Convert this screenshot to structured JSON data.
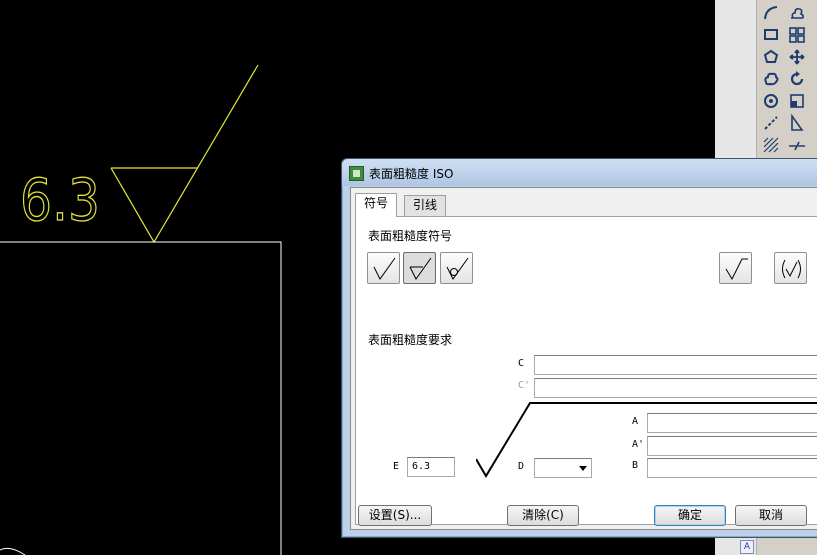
{
  "drawing": {
    "roughness_value": "6.3"
  },
  "dialog": {
    "title": "表面粗糙度 ISO",
    "tabs": [
      {
        "label": "符号"
      },
      {
        "label": "引线"
      }
    ],
    "symbol_section_title": "表面粗糙度符号",
    "symbol_buttons": [
      {
        "icon": "basic-surface-symbol-icon"
      },
      {
        "icon": "material-removal-required-icon"
      },
      {
        "icon": "material-removal-prohibited-icon"
      },
      {
        "icon": "all-around-symbol-icon"
      },
      {
        "icon": "parenthesized-symbol-icon"
      }
    ],
    "requirements_section_title": "表面粗糙度要求",
    "fields": {
      "C": {
        "label": "C",
        "value": ""
      },
      "C_prime": {
        "label": "C'",
        "value": ""
      },
      "A": {
        "label": "A",
        "value": ""
      },
      "A_prime": {
        "label": "A'",
        "value": ""
      },
      "B": {
        "label": "B",
        "value": ""
      },
      "E": {
        "label": "E",
        "value": "6.3"
      },
      "D": {
        "label": "D",
        "value": ""
      }
    },
    "buttons": {
      "settings": "设置(S)...",
      "clear": "清除(C)",
      "ok": "确定",
      "cancel": "取消"
    }
  },
  "toolbar": {
    "icons": [
      "arc-icon",
      "cloud-revision-icon",
      "rectangle-icon",
      "array-icon",
      "polygon-icon",
      "move-icon",
      "spline-cloud-icon",
      "rotate-icon",
      "donut-icon",
      "scale-icon",
      "line-icon",
      "stretch-icon",
      "hatch-icon",
      "break-icon"
    ],
    "bottom_label": "A"
  },
  "colors": {
    "canvas_background": "#000000",
    "drawing_yellow": "#e6e63a",
    "drawing_white": "#ffffff",
    "dialog_frame": "#bcd0e8"
  }
}
